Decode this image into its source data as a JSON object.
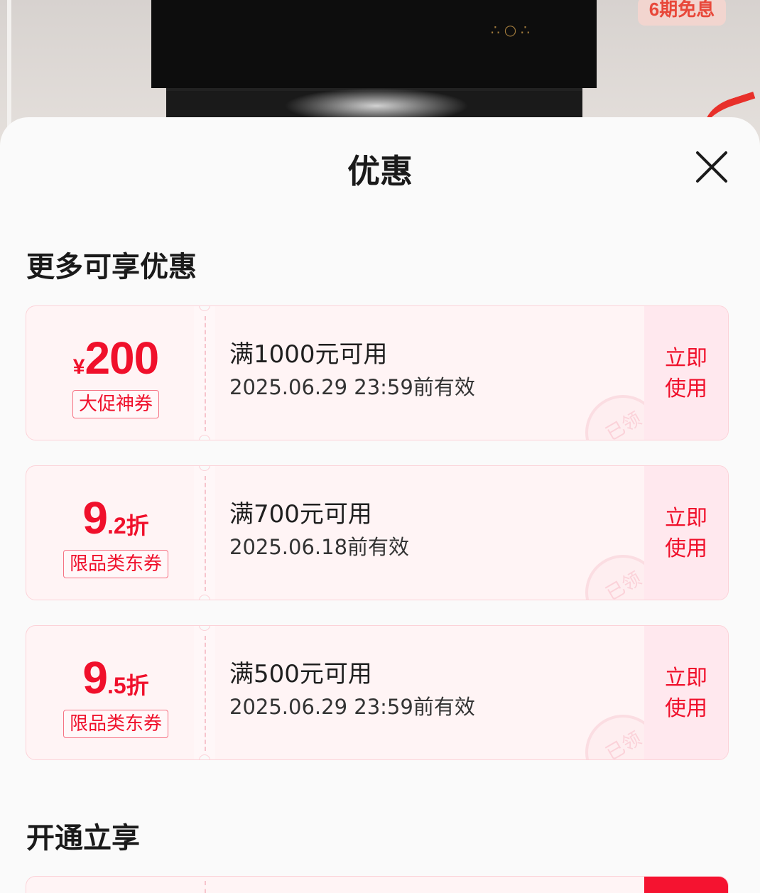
{
  "background": {
    "promo_badge": "6期免息"
  },
  "sheet": {
    "title": "优惠",
    "close_icon": "close-icon"
  },
  "sections": {
    "more_discounts_title": "更多可享优惠",
    "activate_title": "开通立享"
  },
  "coupons": [
    {
      "currency": "¥",
      "amount": "200",
      "tag": "大促神券",
      "condition": "满1000元可用",
      "validity": "2025.06.29 23:59前有效",
      "action_line1": "立即",
      "action_line2": "使用",
      "stamp": "已领"
    },
    {
      "amount_int": "9",
      "amount_dec": ".2折",
      "tag": "限品类东券",
      "condition": "满700元可用",
      "validity": "2025.06.18前有效",
      "action_line1": "立即",
      "action_line2": "使用",
      "stamp": "已领"
    },
    {
      "amount_int": "9",
      "amount_dec": ".5折",
      "tag": "限品类东券",
      "condition": "满500元可用",
      "validity": "2025.06.29 23:59前有效",
      "action_line1": "立即",
      "action_line2": "使用",
      "stamp": "已领"
    }
  ],
  "colors": {
    "accent_red": "#f0102b",
    "coupon_bg": "#fff4f5",
    "coupon_border": "#fcd2d8",
    "action_bg": "#ffe8ee"
  }
}
